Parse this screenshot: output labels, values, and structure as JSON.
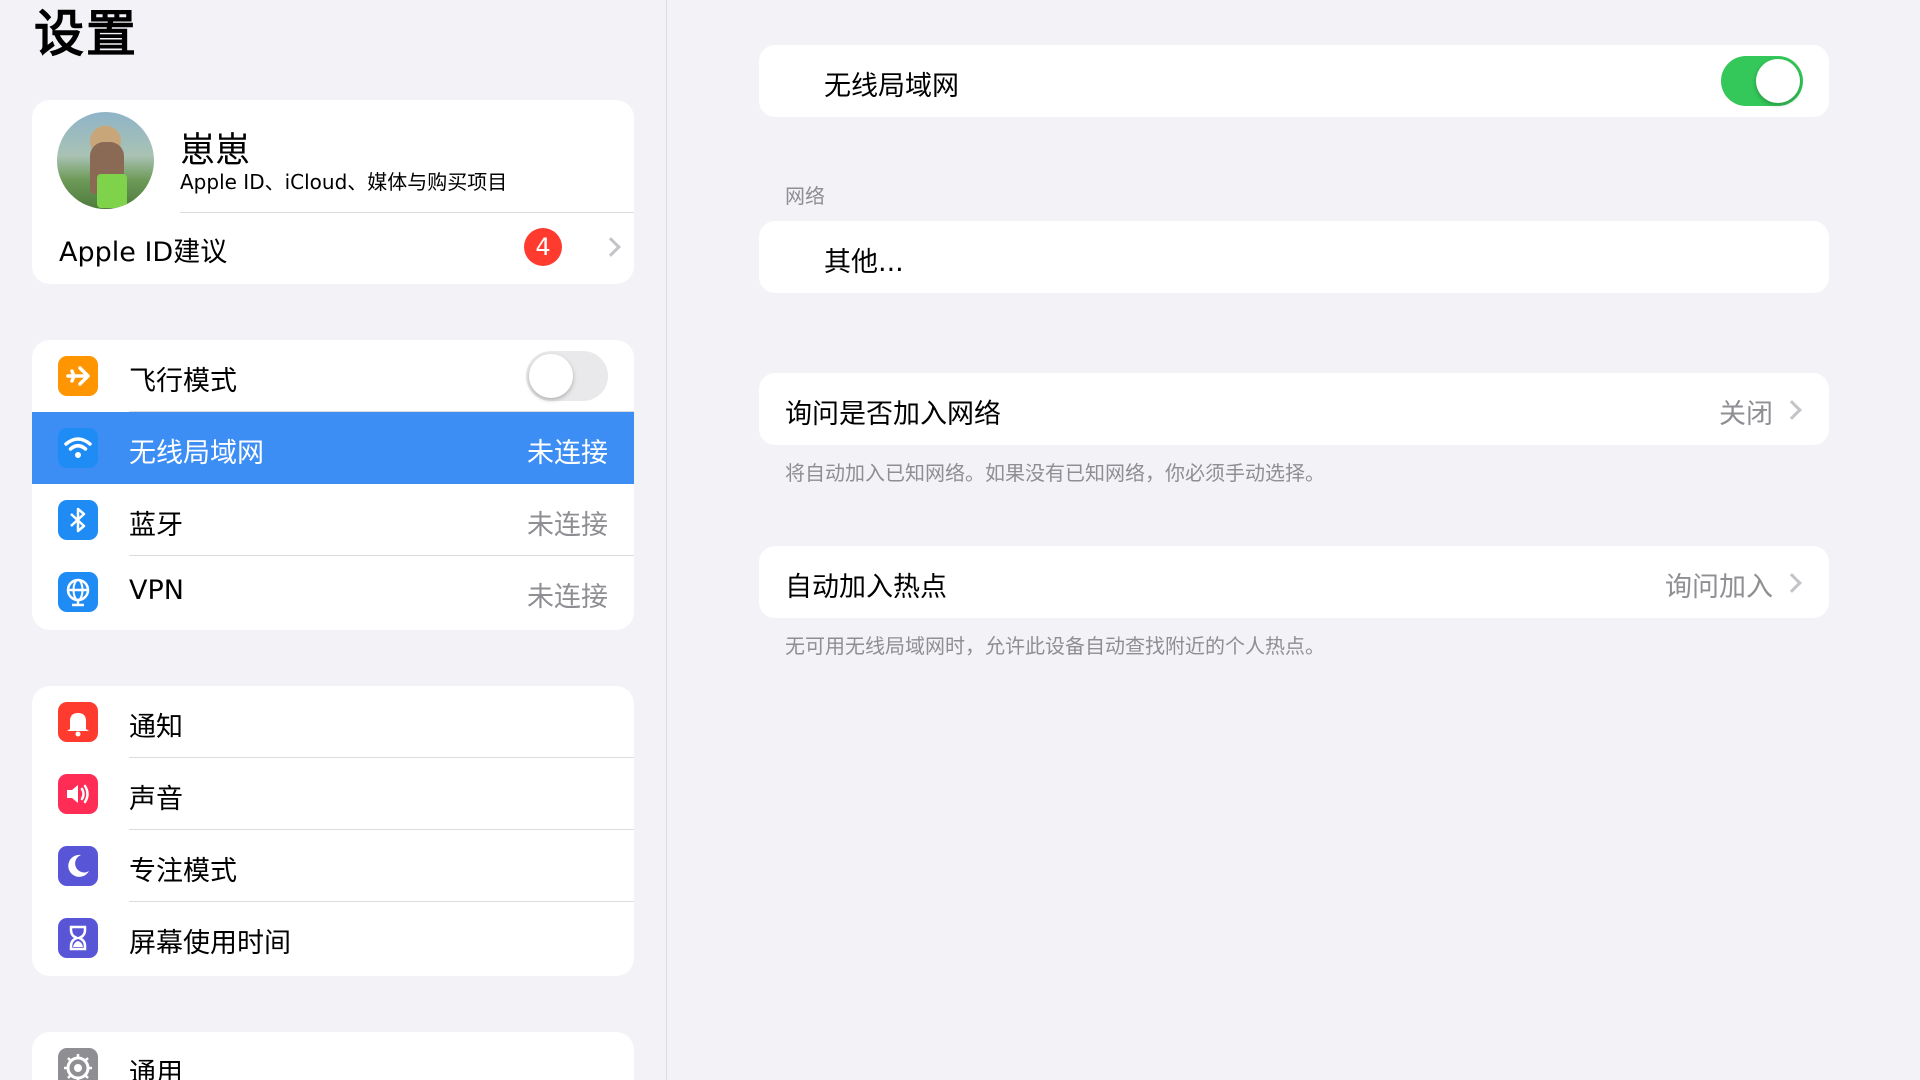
{
  "sidebar": {
    "title": "设置",
    "profile": {
      "name": "崽崽",
      "subtitle": "Apple ID、iCloud、媒体与购买项目",
      "suggestion_label": "Apple ID建议",
      "suggestion_badge": "4"
    },
    "connectivity": [
      {
        "label": "飞行模式",
        "icon": "airplane-icon",
        "icon_color": "#ff9500",
        "toggle": false
      },
      {
        "label": "无线局域网",
        "value": "未连接",
        "icon": "wifi-icon",
        "icon_color": "#1f8bf5",
        "selected": true
      },
      {
        "label": "蓝牙",
        "value": "未连接",
        "icon": "bluetooth-icon",
        "icon_color": "#1f8bf5"
      },
      {
        "label": "VPN",
        "value": "未连接",
        "icon": "vpn-globe-icon",
        "icon_color": "#1f8bf5"
      }
    ],
    "notifications": [
      {
        "label": "通知",
        "icon": "bell-icon",
        "icon_color": "#ff3b30"
      },
      {
        "label": "声音",
        "icon": "speaker-icon",
        "icon_color": "#ff2d55"
      },
      {
        "label": "专注模式",
        "icon": "moon-icon",
        "icon_color": "#5856d6"
      },
      {
        "label": "屏幕使用时间",
        "icon": "hourglass-icon",
        "icon_color": "#5856d6"
      }
    ],
    "general": [
      {
        "label": "通用",
        "icon": "gear-icon",
        "icon_color": "#8e8e93"
      }
    ]
  },
  "detail": {
    "wifi_label": "无线局域网",
    "wifi_on": true,
    "networks_header": "网络",
    "other_label": "其他...",
    "ask_join": {
      "label": "询问是否加入网络",
      "value": "关闭"
    },
    "ask_join_footnote": "将自动加入已知网络。如果没有已知网络，你必须手动选择。",
    "auto_hotspot": {
      "label": "自动加入热点",
      "value": "询问加入"
    },
    "auto_hotspot_footnote": "无可用无线局域网时，允许此设备自动查找附近的个人热点。"
  },
  "colors": {
    "accent": "#3c8ef5",
    "toggle_on": "#34c759",
    "badge": "#ff3b30"
  }
}
